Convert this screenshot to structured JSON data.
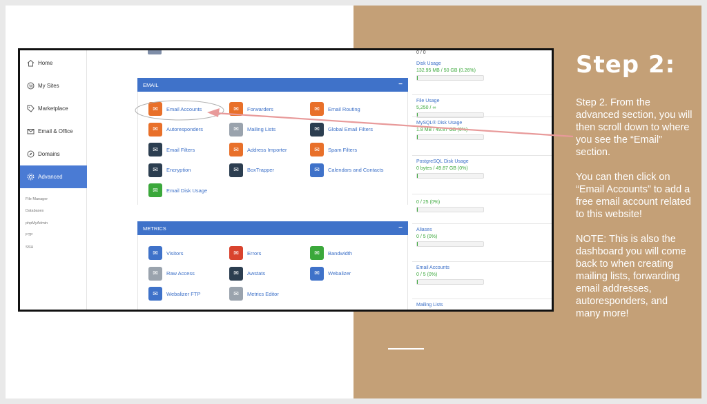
{
  "sidebar": {
    "items": [
      {
        "label": "Home",
        "icon": "home-icon"
      },
      {
        "label": "My Sites",
        "icon": "wordpress-icon"
      },
      {
        "label": "Marketplace",
        "icon": "tag-icon"
      },
      {
        "label": "Email & Office",
        "icon": "envelope-icon"
      },
      {
        "label": "Domains",
        "icon": "compass-icon"
      },
      {
        "label": "Advanced",
        "icon": "gear-icon"
      }
    ],
    "sub_items": [
      "File Manager",
      "Databases",
      "phpMyAdmin",
      "FTP",
      "SSH"
    ]
  },
  "email_panel": {
    "title": "EMAIL",
    "collapse": "−",
    "tools": [
      {
        "label": "Email Accounts",
        "icon": "email-accounts-icon",
        "color": "#e8702a"
      },
      {
        "label": "Forwarders",
        "icon": "forwarders-icon",
        "color": "#e8702a"
      },
      {
        "label": "Email Routing",
        "icon": "email-routing-icon",
        "color": "#e8702a"
      },
      {
        "label": "Autoresponders",
        "icon": "autoresponders-icon",
        "color": "#e8702a"
      },
      {
        "label": "Mailing Lists",
        "icon": "mailing-lists-icon",
        "color": "#9aa3ad"
      },
      {
        "label": "Global Email Filters",
        "icon": "global-filter-icon",
        "color": "#2c3e50"
      },
      {
        "label": "Email Filters",
        "icon": "email-filter-icon",
        "color": "#2c3e50"
      },
      {
        "label": "Address Importer",
        "icon": "address-importer-icon",
        "color": "#e8702a"
      },
      {
        "label": "Spam Filters",
        "icon": "spam-filter-icon",
        "color": "#e8702a"
      },
      {
        "label": "Encryption",
        "icon": "key-icon",
        "color": "#2c3e50"
      },
      {
        "label": "BoxTrapper",
        "icon": "boxtrapper-icon",
        "color": "#2c3e50"
      },
      {
        "label": "Calendars and Contacts",
        "icon": "calendar-icon",
        "color": "#3f72c9"
      },
      {
        "label": "Email Disk Usage",
        "icon": "disk-usage-icon",
        "color": "#3ba83b"
      }
    ]
  },
  "metrics_panel": {
    "title": "METRICS",
    "collapse": "−",
    "tools": [
      {
        "label": "Visitors",
        "icon": "visitors-icon",
        "color": "#3f72c9"
      },
      {
        "label": "Errors",
        "icon": "errors-icon",
        "color": "#d9432e"
      },
      {
        "label": "Bandwidth",
        "icon": "bandwidth-icon",
        "color": "#3ba83b"
      },
      {
        "label": "Raw Access",
        "icon": "raw-access-icon",
        "color": "#9aa3ad"
      },
      {
        "label": "Awstats",
        "icon": "awstats-icon",
        "color": "#2c3e50"
      },
      {
        "label": "Webalizer",
        "icon": "webalizer-icon",
        "color": "#3f72c9"
      },
      {
        "label": "Webalizer FTP",
        "icon": "webalizer-ftp-icon",
        "color": "#3f72c9"
      },
      {
        "label": "Metrics Editor",
        "icon": "metrics-editor-icon",
        "color": "#9aa3ad"
      }
    ]
  },
  "stats": {
    "top_value": "0 / 0",
    "items": [
      {
        "title": "Disk Usage",
        "value": "132.95 MB / 50 GB  (0.26%)",
        "fraction": 0.0026
      },
      {
        "title": "File Usage",
        "value": "5,250 / ∞",
        "fraction": 0
      },
      {
        "title": "MySQL® Disk Usage",
        "value": "1.8 MB / 49.87 GB  (0%)",
        "fraction": 0
      },
      {
        "title": "PostgreSQL Disk Usage",
        "value": "0 bytes / 49.87 GB  (0%)",
        "fraction": 0
      },
      {
        "title": "",
        "value": "0 / 25  (0%)",
        "fraction": 0
      },
      {
        "title": "Aliases",
        "value": "0 / 5  (0%)",
        "fraction": 0
      },
      {
        "title": "Email Accounts",
        "value": "0 / 5  (0%)",
        "fraction": 0
      },
      {
        "title": "Mailing Lists",
        "value": "",
        "fraction": 0
      }
    ]
  },
  "instructions": {
    "title": "Step 2:",
    "paragraphs": [
      "Step 2. From the advanced section, you will then scroll down to where you see the  “Email” section.",
      "You can then click on “Email Accounts” to add a free email account related to this website!",
      "NOTE: This is also the dashboard you will come back to when creating mailing lists, forwarding email addresses, autoresponders, and many more!"
    ]
  },
  "colors": {
    "accent_blue": "#3f72c9",
    "panel_tan": "#c4a077",
    "arrow_pink": "#e89a9a",
    "green": "#3ba83b"
  }
}
